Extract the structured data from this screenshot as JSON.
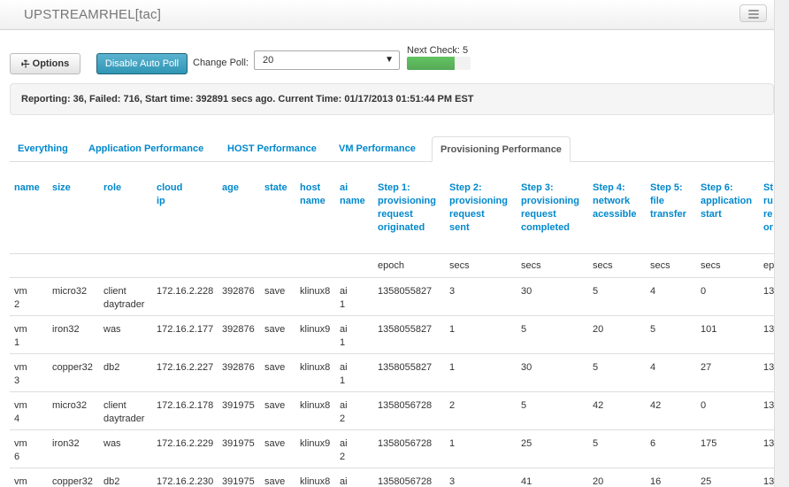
{
  "app": {
    "title": "UPSTREAMRHEL[tac]"
  },
  "toolbar": {
    "options_label": "Options",
    "autopoll_label": "Disable Auto Poll",
    "change_poll_label": "Change Poll:",
    "poll_value": "20",
    "next_check_label": "Next Check: 5",
    "next_check_progress": 0.75
  },
  "status": {
    "text": "Reporting: 36, Failed: 716, Start time: 392891 secs ago. Current Time: 01/17/2013 01:51:44 PM EST"
  },
  "tabs": [
    {
      "label": "Everything"
    },
    {
      "label": "Application Performance"
    },
    {
      "label": "HOST Performance"
    },
    {
      "label": "VM Performance"
    },
    {
      "label": "Provisioning Performance",
      "active": true
    }
  ],
  "table": {
    "columns": [
      {
        "header": [
          "name"
        ],
        "unit": ""
      },
      {
        "header": [
          "size"
        ],
        "unit": ""
      },
      {
        "header": [
          "role"
        ],
        "unit": ""
      },
      {
        "header": [
          "cloud",
          "ip"
        ],
        "unit": ""
      },
      {
        "header": [
          "age"
        ],
        "unit": ""
      },
      {
        "header": [
          "state"
        ],
        "unit": ""
      },
      {
        "header": [
          "host",
          "name"
        ],
        "unit": ""
      },
      {
        "header": [
          "ai",
          "name"
        ],
        "unit": ""
      },
      {
        "header": [
          "Step 1:",
          "provisioning",
          "request",
          "originated"
        ],
        "unit": "epoch"
      },
      {
        "header": [
          "Step 2:",
          "provisioning",
          "request",
          "sent"
        ],
        "unit": "secs"
      },
      {
        "header": [
          "Step 3:",
          "provisioning",
          "request",
          "completed"
        ],
        "unit": "secs"
      },
      {
        "header": [
          "Step 4:",
          "network",
          "acessible"
        ],
        "unit": "secs"
      },
      {
        "header": [
          "Step 5:",
          "file",
          "transfer"
        ],
        "unit": "secs"
      },
      {
        "header": [
          "Step 6:",
          "application",
          "start"
        ],
        "unit": "secs"
      },
      {
        "header": [
          "St",
          "ru",
          "re",
          "or"
        ],
        "unit": "ep"
      }
    ],
    "rows": [
      [
        [
          "vm",
          "2"
        ],
        [
          "micro32"
        ],
        [
          "client",
          "daytrader"
        ],
        [
          "172.16.2.228"
        ],
        [
          "392876"
        ],
        [
          "save"
        ],
        [
          "klinux8"
        ],
        [
          "ai",
          "1"
        ],
        [
          "1358055827"
        ],
        [
          "3"
        ],
        [
          "30"
        ],
        [
          "5"
        ],
        [
          "4"
        ],
        [
          "0"
        ],
        [
          "13"
        ]
      ],
      [
        [
          "vm",
          "1"
        ],
        [
          "iron32"
        ],
        [
          "was"
        ],
        [
          "172.16.2.177"
        ],
        [
          "392876"
        ],
        [
          "save"
        ],
        [
          "klinux9"
        ],
        [
          "ai",
          "1"
        ],
        [
          "1358055827"
        ],
        [
          "1"
        ],
        [
          "5"
        ],
        [
          "20"
        ],
        [
          "5"
        ],
        [
          "101"
        ],
        [
          "13"
        ]
      ],
      [
        [
          "vm",
          "3"
        ],
        [
          "copper32"
        ],
        [
          "db2"
        ],
        [
          "172.16.2.227"
        ],
        [
          "392876"
        ],
        [
          "save"
        ],
        [
          "klinux8"
        ],
        [
          "ai",
          "1"
        ],
        [
          "1358055827"
        ],
        [
          "1"
        ],
        [
          "30"
        ],
        [
          "5"
        ],
        [
          "4"
        ],
        [
          "27"
        ],
        [
          "13"
        ]
      ],
      [
        [
          "vm",
          "4"
        ],
        [
          "micro32"
        ],
        [
          "client",
          "daytrader"
        ],
        [
          "172.16.2.178"
        ],
        [
          "391975"
        ],
        [
          "save"
        ],
        [
          "klinux8"
        ],
        [
          "ai",
          "2"
        ],
        [
          "1358056728"
        ],
        [
          "2"
        ],
        [
          "5"
        ],
        [
          "42"
        ],
        [
          "42"
        ],
        [
          "0"
        ],
        [
          "13"
        ]
      ],
      [
        [
          "vm",
          "6"
        ],
        [
          "iron32"
        ],
        [
          "was"
        ],
        [
          "172.16.2.229"
        ],
        [
          "391975"
        ],
        [
          "save"
        ],
        [
          "klinux9"
        ],
        [
          "ai",
          "2"
        ],
        [
          "1358056728"
        ],
        [
          "1"
        ],
        [
          "25"
        ],
        [
          "5"
        ],
        [
          "6"
        ],
        [
          "175"
        ],
        [
          "13"
        ]
      ],
      [
        [
          "vm",
          "5"
        ],
        [
          "copper32"
        ],
        [
          "db2"
        ],
        [
          "172.16.2.230"
        ],
        [
          "391975"
        ],
        [
          "save"
        ],
        [
          "klinux8"
        ],
        [
          "ai",
          "2"
        ],
        [
          "1358056728"
        ],
        [
          "3"
        ],
        [
          "41"
        ],
        [
          "20"
        ],
        [
          "16"
        ],
        [
          "25"
        ],
        [
          "13"
        ]
      ]
    ]
  }
}
